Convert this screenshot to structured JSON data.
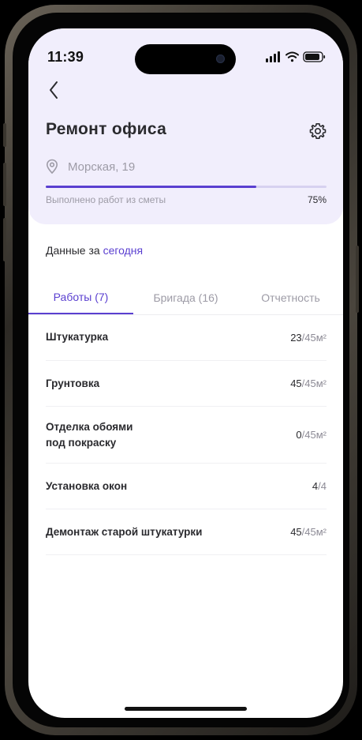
{
  "status_bar": {
    "time": "11:39"
  },
  "header": {
    "back_icon": "chevron-left-icon",
    "title": "Ремонт офиса",
    "settings_icon": "gear-icon",
    "location_icon": "map-pin-icon",
    "location": "Морская, 19",
    "progress": {
      "label": "Выполнено работ из сметы",
      "value_percent": 75,
      "value_text": "75%"
    }
  },
  "period": {
    "prefix": "Данные за",
    "link": "сегодня"
  },
  "tabs": [
    {
      "label": "Работы (7)",
      "active": true
    },
    {
      "label": "Бригада (16)",
      "active": false
    },
    {
      "label": "Отчетность",
      "active": false
    }
  ],
  "works": [
    {
      "name": "Штукатурка",
      "done": "23",
      "total": "/45м²"
    },
    {
      "name": "Грунтовка",
      "done": "45",
      "total": "/45м²"
    },
    {
      "name": "Отделка обоями под покраску",
      "done": "0",
      "total": "/45м²"
    },
    {
      "name": "Установка окон",
      "done": "4",
      "total": "/4"
    },
    {
      "name": "Демонтаж старой штукатурки",
      "done": "45",
      "total": "/45м²"
    }
  ],
  "colors": {
    "accent": "#5a3fd0",
    "header_bg": "#f1eefc",
    "muted_text": "#9d9ba6",
    "primary_text": "#2a2a2e"
  }
}
